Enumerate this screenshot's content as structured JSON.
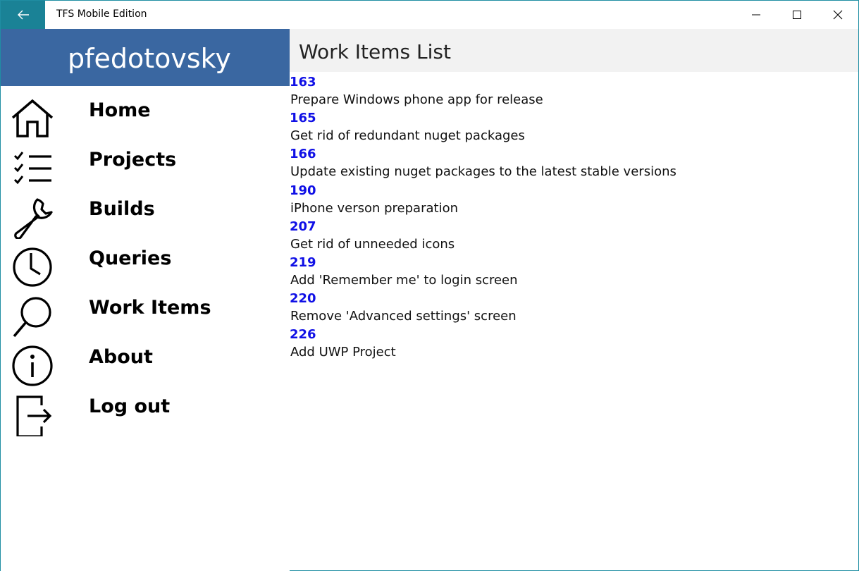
{
  "window": {
    "title": "TFS Mobile Edition",
    "accent_color": "#1a8296",
    "back_icon": "arrow-left-icon",
    "controls": [
      "minimize-icon",
      "maximize-icon",
      "close-icon"
    ]
  },
  "sidebar": {
    "user_name": "pfedotovsky",
    "header_color": "#3a67a1",
    "items": [
      {
        "label": "Home",
        "icon": "home-icon"
      },
      {
        "label": "Projects",
        "icon": "checklist-icon"
      },
      {
        "label": "Builds",
        "icon": "wrench-icon"
      },
      {
        "label": "Queries",
        "icon": "clock-icon"
      },
      {
        "label": "Work Items",
        "icon": "search-icon"
      },
      {
        "label": "About",
        "icon": "info-icon"
      },
      {
        "label": "Log out",
        "icon": "logout-icon"
      }
    ]
  },
  "main": {
    "title": "Work Items List",
    "id_color": "#1010e6",
    "work_items": [
      {
        "id": "163",
        "title": "Prepare Windows phone app for release"
      },
      {
        "id": "165",
        "title": "Get rid of redundant nuget packages"
      },
      {
        "id": "166",
        "title": "Update existing nuget packages to the latest stable versions"
      },
      {
        "id": "190",
        "title": "iPhone verson preparation"
      },
      {
        "id": "207",
        "title": "Get rid of unneeded icons"
      },
      {
        "id": "219",
        "title": "Add 'Remember me' to login screen"
      },
      {
        "id": "220",
        "title": "Remove 'Advanced settings' screen"
      },
      {
        "id": "226",
        "title": "Add UWP Project"
      }
    ]
  }
}
